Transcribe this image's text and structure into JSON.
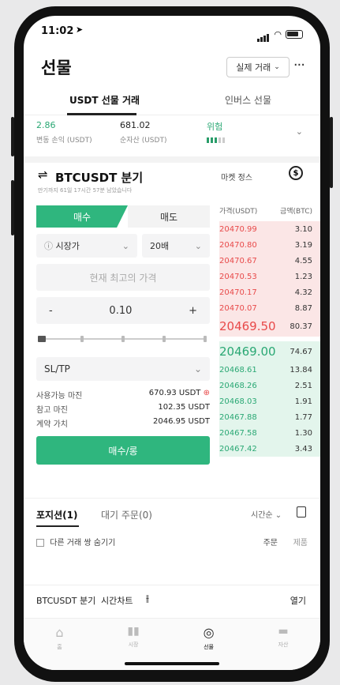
{
  "status": {
    "time": "11:02"
  },
  "header": {
    "title": "선물",
    "mode_label": "실제 거래",
    "more": "···"
  },
  "tabs": [
    {
      "label": "USDT 선물 거래"
    },
    {
      "label": "인버스 선물"
    }
  ],
  "stats": {
    "pnl_value": "2.86",
    "pnl_label": "변동 손익 (USDT)",
    "equity_value": "681.02",
    "equity_label": "순자산 (USDT)",
    "risk_label": "위험"
  },
  "symbol": {
    "name": "BTCUSDT 분기",
    "sub": "만기까지 61일 17시간 57분 남았습니다",
    "market_info": "마켓 정스"
  },
  "order": {
    "buy": "매수",
    "sell": "매도",
    "order_type": "시장가",
    "leverage": "20배",
    "price_placeholder": "현재 최고의 가격",
    "qty_minus": "-",
    "qty_value": "0.10",
    "qty_plus": "+",
    "sltp": "SL/TP",
    "available_label": "사용가능 마진",
    "available_value": "670.93 USDT",
    "margin_label": "참고 마진",
    "margin_value": "102.35 USDT",
    "contract_label": "계약 가치",
    "contract_value": "2046.95 USDT",
    "submit": "매수/롱"
  },
  "orderbook": {
    "price_header": "가격(USDT)",
    "amount_header": "금액(BTC)",
    "asks": [
      {
        "price": "20470.99",
        "amount": "3.10"
      },
      {
        "price": "20470.80",
        "amount": "3.19"
      },
      {
        "price": "20470.67",
        "amount": "4.55"
      },
      {
        "price": "20470.53",
        "amount": "1.23"
      },
      {
        "price": "20470.17",
        "amount": "4.32"
      },
      {
        "price": "20470.07",
        "amount": "8.87"
      }
    ],
    "ask_mid": {
      "price": "20469.50",
      "amount": "80.37"
    },
    "bid_mid": {
      "price": "20469.00",
      "amount": "74.67"
    },
    "bids": [
      {
        "price": "20468.61",
        "amount": "13.84"
      },
      {
        "price": "20468.26",
        "amount": "2.51"
      },
      {
        "price": "20468.03",
        "amount": "1.91"
      },
      {
        "price": "20467.88",
        "amount": "1.77"
      },
      {
        "price": "20467.58",
        "amount": "1.30"
      },
      {
        "price": "20467.42",
        "amount": "3.43"
      }
    ]
  },
  "positions": {
    "tab_positions": "포지션(1)",
    "tab_pending": "대기 주문(0)",
    "sort": "시간순",
    "other_pairs": "다른 거래 쌍 숨기기",
    "col_order": "주문",
    "col_cancel": "제품"
  },
  "bottom_strip": {
    "symbol": "BTCUSDT 분기",
    "chart": "시간차트",
    "open": "열기"
  },
  "nav": [
    {
      "label": "홈"
    },
    {
      "label": "시장"
    },
    {
      "label": "선물"
    },
    {
      "label": "자산"
    }
  ]
}
